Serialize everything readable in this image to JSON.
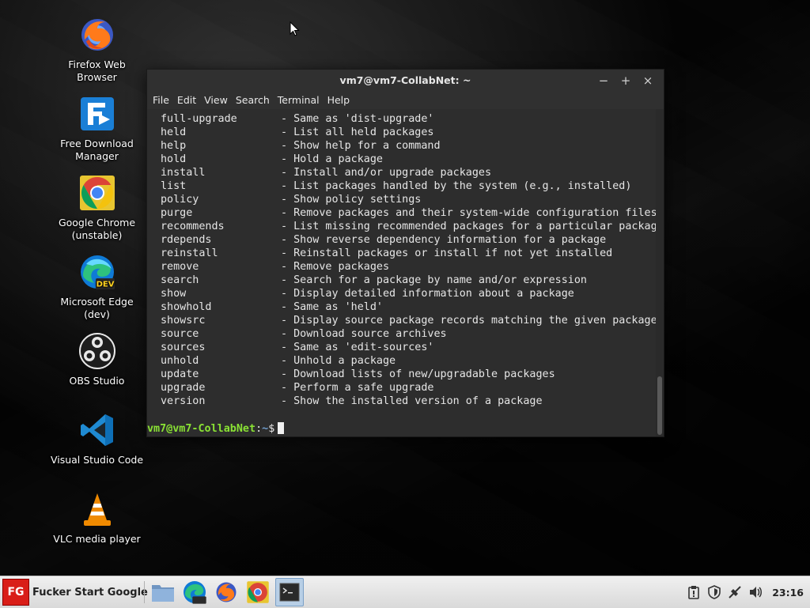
{
  "desktop": {
    "icons": [
      {
        "label": "Firefox Web Browser",
        "icon": "firefox-icon"
      },
      {
        "label": "Free Download Manager",
        "icon": "download-manager-icon"
      },
      {
        "label": "Google Chrome (unstable)",
        "icon": "chrome-icon"
      },
      {
        "label": "Microsoft Edge (dev)",
        "icon": "edge-dev-icon",
        "badge": "DEV"
      },
      {
        "label": "OBS Studio",
        "icon": "obs-icon"
      },
      {
        "label": "Visual Studio Code",
        "icon": "vscode-icon"
      },
      {
        "label": "VLC media player",
        "icon": "vlc-icon"
      }
    ]
  },
  "window": {
    "title": "vm7@vm7-CollabNet: ~",
    "controls": {
      "minimize": "−",
      "maximize": "+",
      "close": "×"
    },
    "menu": [
      "File",
      "Edit",
      "View",
      "Search",
      "Terminal",
      "Help"
    ]
  },
  "terminal": {
    "lines": [
      {
        "cmd": "full-upgrade",
        "desc": "- Same as 'dist-upgrade'"
      },
      {
        "cmd": "held",
        "desc": "- List all held packages"
      },
      {
        "cmd": "help",
        "desc": "- Show help for a command"
      },
      {
        "cmd": "hold",
        "desc": "- Hold a package"
      },
      {
        "cmd": "install",
        "desc": "- Install and/or upgrade packages"
      },
      {
        "cmd": "list",
        "desc": "- List packages handled by the system (e.g., installed)"
      },
      {
        "cmd": "policy",
        "desc": "- Show policy settings"
      },
      {
        "cmd": "purge",
        "desc": "- Remove packages and their system-wide configuration files"
      },
      {
        "cmd": "recommends",
        "desc": "- List missing recommended packages for a particular package"
      },
      {
        "cmd": "rdepends",
        "desc": "- Show reverse dependency information for a package"
      },
      {
        "cmd": "reinstall",
        "desc": "- Reinstall packages or install if not yet installed"
      },
      {
        "cmd": "remove",
        "desc": "- Remove packages"
      },
      {
        "cmd": "search",
        "desc": "- Search for a package by name and/or expression"
      },
      {
        "cmd": "show",
        "desc": "- Display detailed information about a package"
      },
      {
        "cmd": "showhold",
        "desc": "- Same as 'held'"
      },
      {
        "cmd": "showsrc",
        "desc": "- Display source package records matching the given package"
      },
      {
        "cmd": "source",
        "desc": "- Download source archives"
      },
      {
        "cmd": "sources",
        "desc": "- Same as 'edit-sources'"
      },
      {
        "cmd": "unhold",
        "desc": "- Unhold a package"
      },
      {
        "cmd": "update",
        "desc": "- Download lists of new/upgradable packages"
      },
      {
        "cmd": "upgrade",
        "desc": "- Perform a safe upgrade"
      },
      {
        "cmd": "version",
        "desc": "- Show the installed version of a package"
      }
    ],
    "prompt_user": "vm7@vm7-CollabNet",
    "prompt_sep": ":",
    "prompt_path": "~",
    "prompt_symbol": "$"
  },
  "taskbar": {
    "start_logo": "FG",
    "start_label": "Fucker Start Google",
    "apps": [
      "files-icon",
      "edge-dev-icon",
      "firefox-icon",
      "chrome-icon",
      "terminal-icon"
    ],
    "clock": "23:16"
  }
}
